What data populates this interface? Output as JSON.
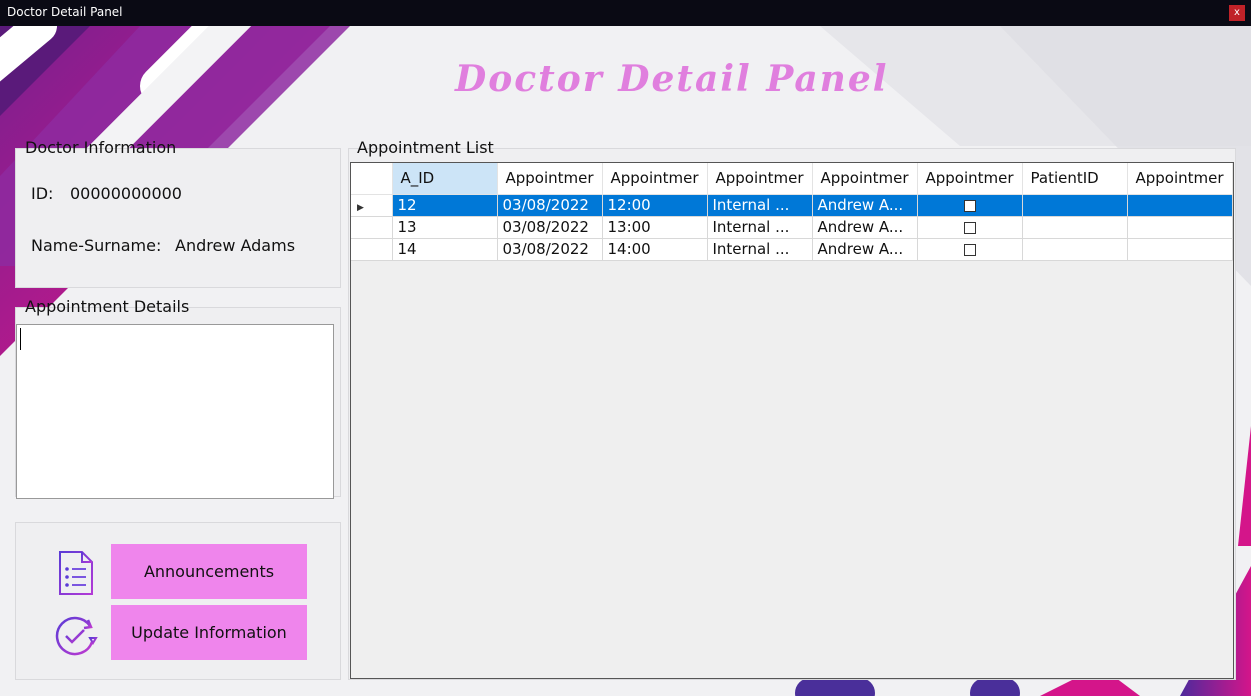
{
  "window": {
    "title": "Doctor Detail Panel",
    "close_label": "x"
  },
  "header": {
    "title": "Doctor Detail Panel"
  },
  "doctor_info": {
    "label": "Doctor Information",
    "id_label": "ID:",
    "id_value": "00000000000",
    "name_label": "Name-Surname:",
    "name_value": "Andrew Adams"
  },
  "appointment_details": {
    "label": "Appointment Details",
    "value": ""
  },
  "buttons": {
    "announcements": "Announcements",
    "update_information": "Update Information"
  },
  "appointment_list": {
    "label": "Appointment List",
    "columns": [
      "A_ID",
      "Appointmer",
      "Appointmer",
      "Appointmer",
      "Appointmer",
      "Appointmer",
      "PatientID",
      "Appointmer"
    ],
    "rows": [
      {
        "a_id": "12",
        "date": "03/08/2022",
        "time": "12:00",
        "clinic": "Internal ...",
        "doctor": "Andrew A...",
        "status": false,
        "patient": "",
        "extra": ""
      },
      {
        "a_id": "13",
        "date": "03/08/2022",
        "time": "13:00",
        "clinic": "Internal ...",
        "doctor": "Andrew A...",
        "status": false,
        "patient": "",
        "extra": ""
      },
      {
        "a_id": "14",
        "date": "03/08/2022",
        "time": "14:00",
        "clinic": "Internal ...",
        "doctor": "Andrew A...",
        "status": false,
        "patient": "",
        "extra": ""
      }
    ],
    "selected_row": 0
  },
  "colors": {
    "accent": "#ef85ec",
    "title": "#e07fde",
    "selection": "#0078d7",
    "header_selected": "#cce4f7"
  },
  "icons": {
    "announcements": "document-list-icon",
    "update": "refresh-check-icon"
  }
}
